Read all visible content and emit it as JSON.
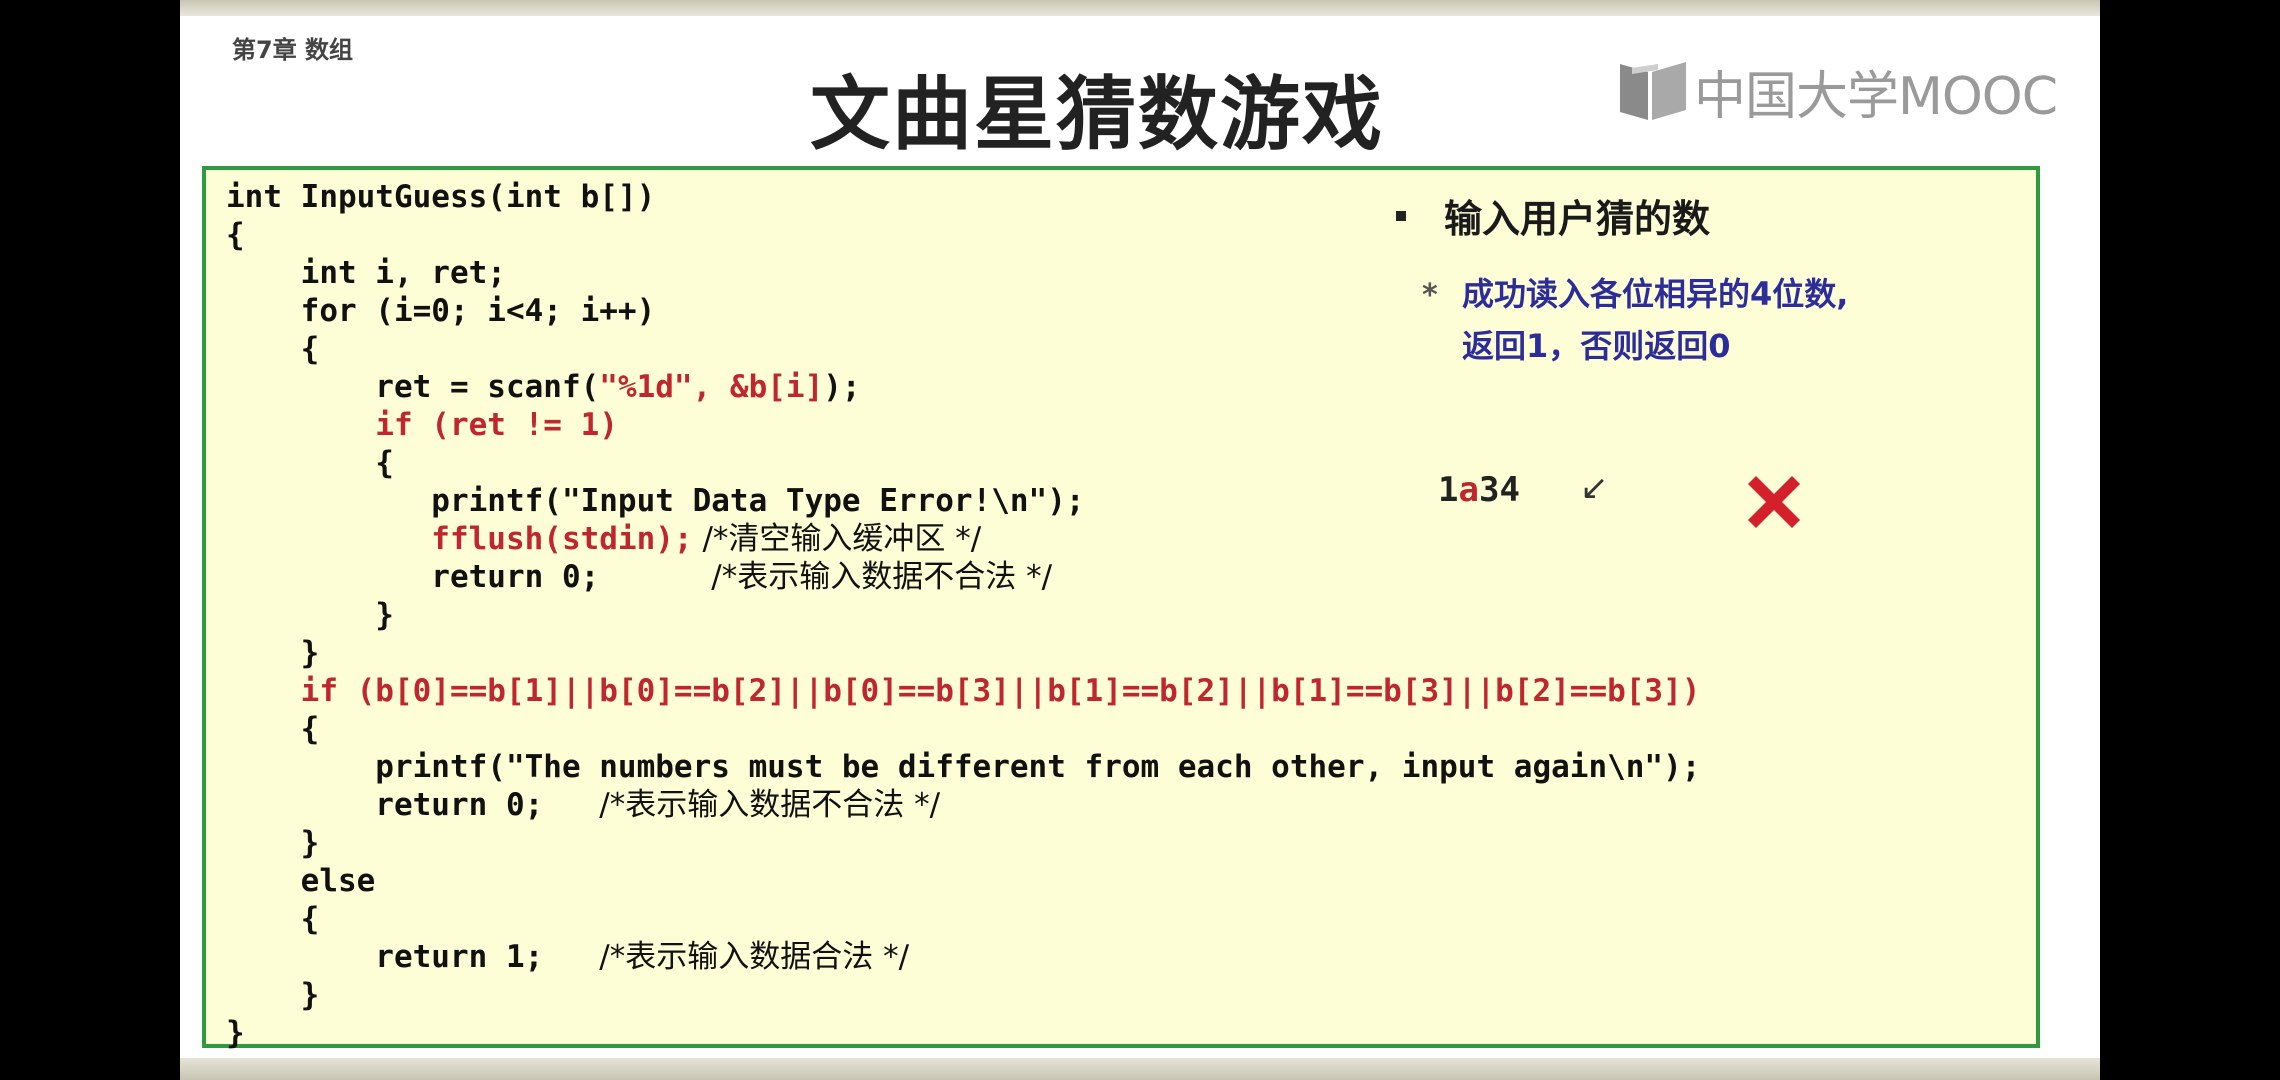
{
  "slide": {
    "chapter": "第7章 数组",
    "title": "文曲星猜数游戏",
    "logo_text": "中国大学MOOC"
  },
  "code": {
    "l01": "int InputGuess(int b[])",
    "l02": "{",
    "l03": "    int i, ret;",
    "l04": "    for (i=0; i<4; i++)",
    "l05": "    {",
    "l06a": "        ret = scanf(",
    "l06b": "\"%1d\", &b[i]",
    "l06c": ");",
    "l07": "        if (ret != 1)",
    "l08": "        {",
    "l09": "           printf(\"Input Data Type Error!\\n\");",
    "l10a": "           fflush(stdin);",
    "l10b": " /*清空输入缓冲区 */",
    "l11a": "           return 0;      ",
    "l11b": "/*表示输入数据不合法 */",
    "l12": "        }",
    "l13": "    }",
    "l14": "    if (b[0]==b[1]||b[0]==b[2]||b[0]==b[3]||b[1]==b[2]||b[1]==b[3]||b[2]==b[3])",
    "l15": "    {",
    "l16": "        printf(\"The numbers must be different from each other, input again\\n\");",
    "l17a": "        return 0;   ",
    "l17b": "/*表示输入数据不合法 */",
    "l18": "    }",
    "l19": "    else",
    "l20": "    {",
    "l21a": "        return 1;   ",
    "l21b": "/*表示输入数据合法 */",
    "l22": "    }",
    "l23": "}"
  },
  "notes": {
    "bullet": "输入用户猜的数",
    "sub_line1": "成功读入各位相异的4位数,",
    "sub_line2": "返回1，否则返回0",
    "example_a": "1",
    "example_b": "a",
    "example_c": "34",
    "arrow": "↙"
  },
  "colors": {
    "code_bg": "#fdfdd6",
    "border": "#2e9b3f",
    "keyword_red": "#c0262d",
    "note_blue": "#2c2c9a",
    "cross": "#d4202a"
  }
}
